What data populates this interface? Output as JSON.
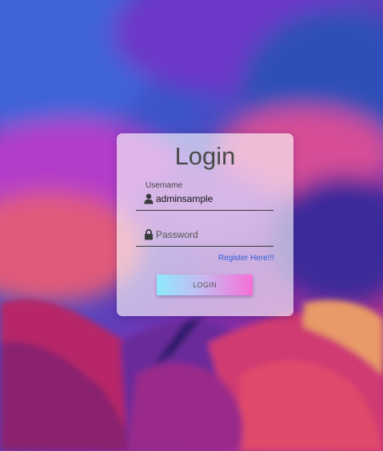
{
  "login": {
    "title": "Login",
    "username": {
      "label": "Username",
      "value": "adminsample",
      "icon": "user-icon"
    },
    "password": {
      "placeholder": "Password",
      "value": "",
      "icon": "lock-icon"
    },
    "register_link": "Register Here!!!",
    "submit_label": "LOGIN"
  },
  "colors": {
    "link": "#2d5bd4",
    "button_gradient_start": "#8ee9fb",
    "button_gradient_end": "#f66fd6",
    "title": "#4a4a4a"
  }
}
